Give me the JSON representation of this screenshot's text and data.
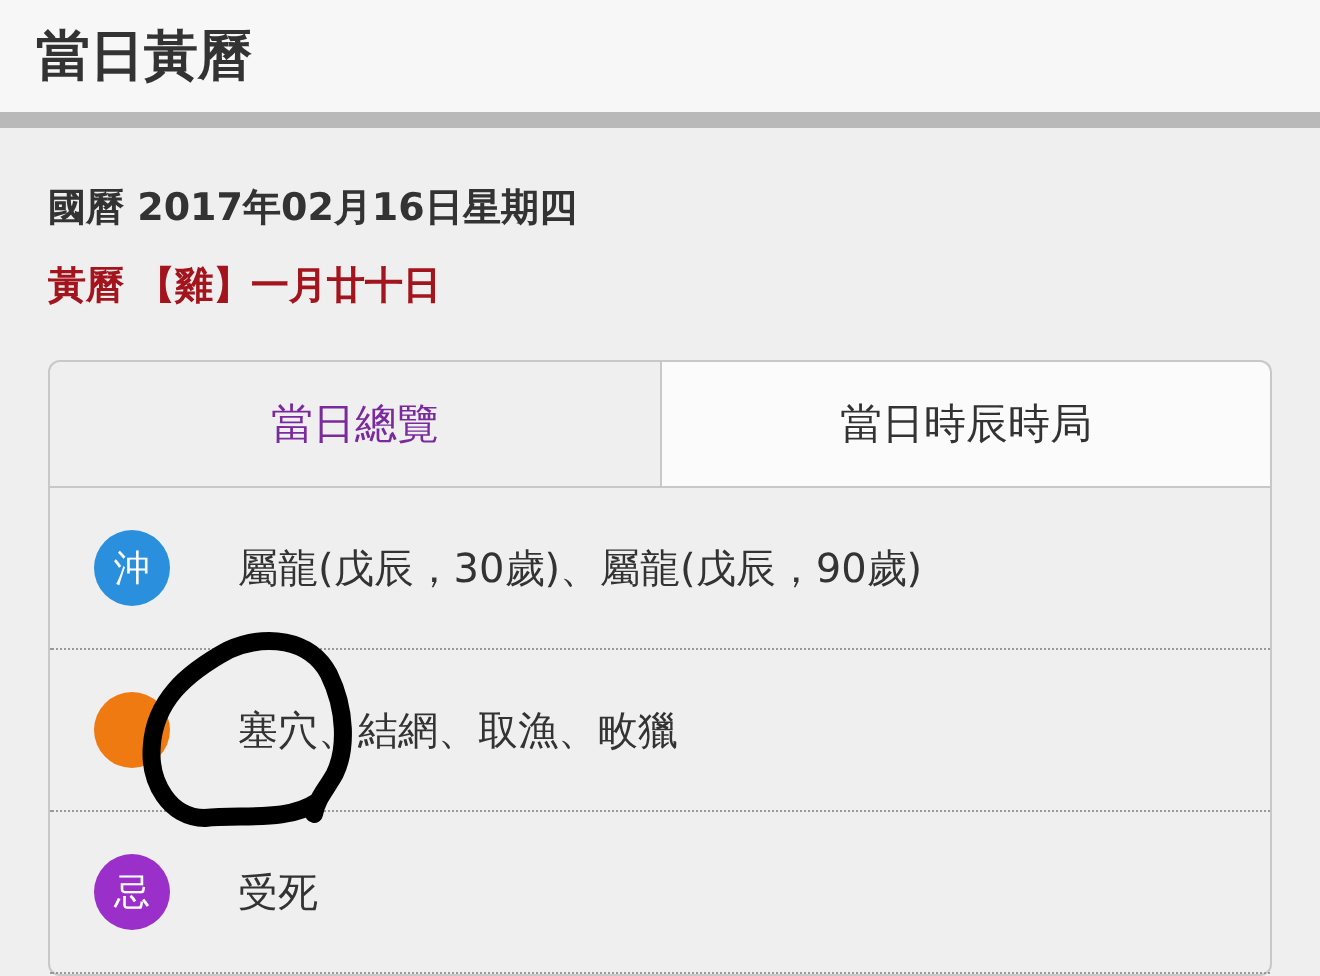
{
  "header": {
    "title": "當日黃曆"
  },
  "gregorian": "國曆 2017年02月16日星期四",
  "lunar": "黃曆 【雞】一月廿十日",
  "tabs": [
    {
      "label": "當日總覽",
      "selected": true
    },
    {
      "label": "當日時辰時局",
      "selected": false
    }
  ],
  "rows": [
    {
      "badge": "沖",
      "color": "#2a8fdc",
      "text": "屬龍(戊辰，30歲)、屬龍(戊辰，90歲)"
    },
    {
      "color": "#f07a12",
      "text": "塞穴、結網、取漁、畋獵"
    },
    {
      "badge": "忌",
      "color": "#9b2fc9",
      "text": "受死"
    }
  ],
  "annotation": {
    "kind": "circle"
  }
}
